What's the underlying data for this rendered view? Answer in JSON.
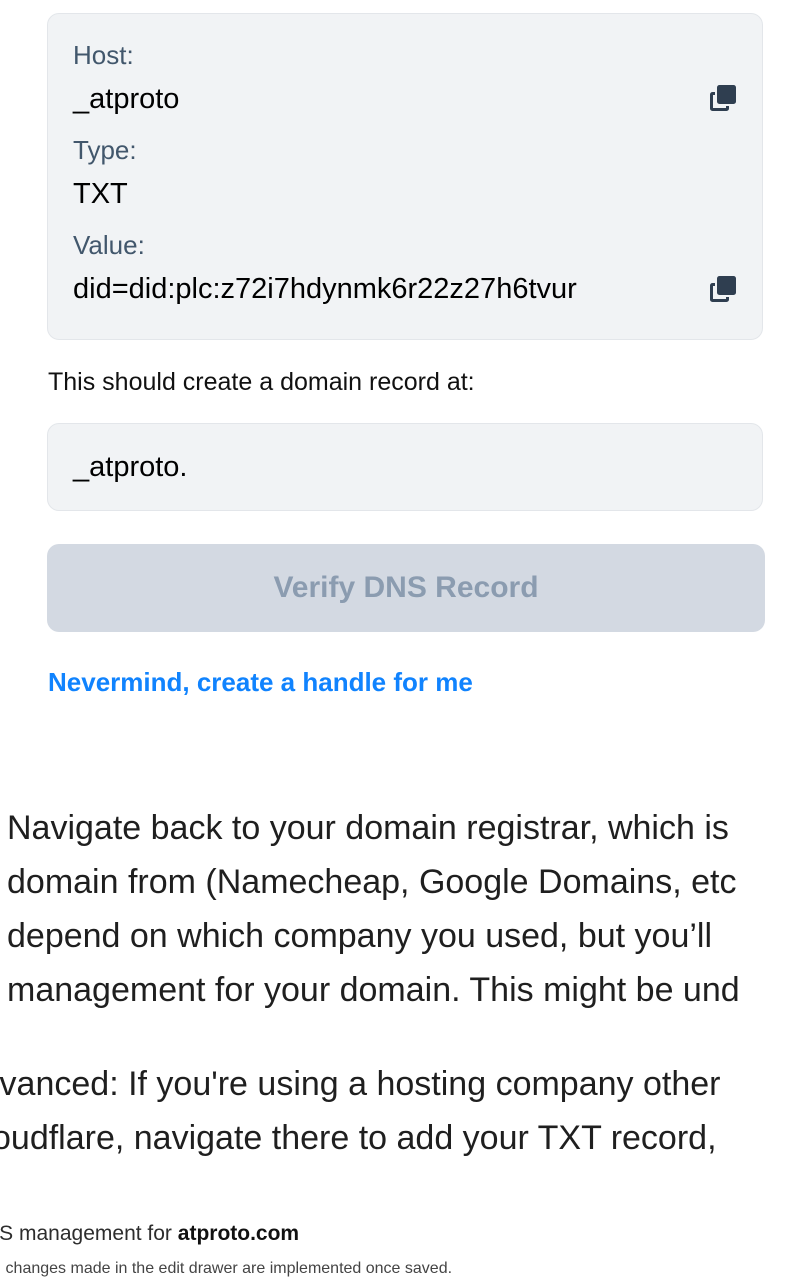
{
  "record": {
    "host_label": "Host:",
    "host_value": "_atproto",
    "type_label": "Type:",
    "type_value": "TXT",
    "value_label": "Value:",
    "value_value": "did=did:plc:z72i7hdynmk6r22z27h6tvur"
  },
  "record_hint": "This should create a domain record at:",
  "domain_record": "_atproto.",
  "verify_button": "Verify DNS Record",
  "nevermind_link": "Nevermind, create a handle for me",
  "article": {
    "paragraph1_lines": [
      "Navigate back to your domain registrar, which is",
      "domain from (Namecheap, Google Domains, etc",
      "depend on which company you used, but you’ll",
      "management for your domain. This might be und"
    ],
    "paragraph2_lines": [
      "lvanced: If you're using a hosting company other",
      "oudflare, navigate there to add your TXT record,"
    ]
  },
  "dns_panel": {
    "heading_prefix": "NS management for ",
    "heading_domain": "atproto.com",
    "subtext": "ll changes made in the edit drawer are implemented once saved."
  },
  "icons": {
    "copy": "copy-icon"
  },
  "colors": {
    "accent": "#1083fe",
    "box_bg": "#f1f3f5",
    "button_disabled_bg": "#d3d9e2",
    "button_disabled_text": "#8b9cb0",
    "label": "#42576c"
  }
}
